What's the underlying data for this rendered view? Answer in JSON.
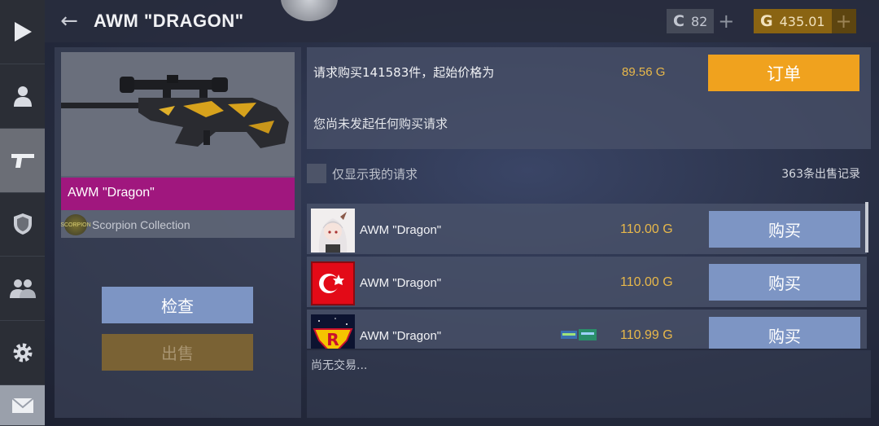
{
  "header": {
    "title": "AWM \"DRAGON\"",
    "credits": "82",
    "gold": "435.01"
  },
  "nav": {
    "items": [
      "play-icon",
      "profile-icon",
      "weapon-icon",
      "shield-icon",
      "team-icon",
      "gear-icon",
      "mail-icon"
    ]
  },
  "item": {
    "name": "AWM \"Dragon\"",
    "collection": "Scorpion Collection",
    "collection_icon_text": "SCORPION",
    "inspect_label": "检查",
    "sell_label": "出售",
    "rarity_color": "#a0177e"
  },
  "request": {
    "text": "请求购买141583件，起始价格为",
    "price": "89.56 G",
    "order_label": "订单",
    "none_text": "您尚未发起任何购买请求"
  },
  "filter": {
    "label": "仅显示我的请求",
    "record_count": "363条出售记录"
  },
  "listings": [
    {
      "name": "AWM \"Dragon\"",
      "price": "110.00 G",
      "buy_label": "购买",
      "avatar": "anime-avatar"
    },
    {
      "name": "AWM \"Dragon\"",
      "price": "110.00 G",
      "buy_label": "购买",
      "avatar": "turkey-flag-avatar"
    },
    {
      "name": "AWM \"Dragon\"",
      "price": "110.99 G",
      "buy_label": "购买",
      "avatar": "r-logo-avatar",
      "sticker": true
    }
  ],
  "footer": {
    "no_trade": "尚无交易..."
  }
}
